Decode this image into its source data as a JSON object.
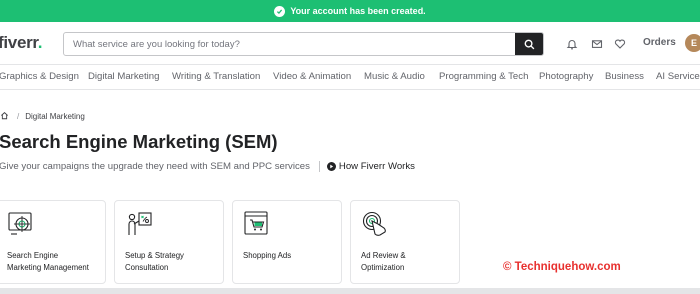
{
  "banner": {
    "message": "Your account has been created."
  },
  "header": {
    "logo": "fiverr",
    "logo_dot": ".",
    "search_placeholder": "What service are you looking for today?",
    "orders_label": "Orders",
    "avatar_initial": "E"
  },
  "categories": [
    "Graphics & Design",
    "Digital Marketing",
    "Writing & Translation",
    "Video & Animation",
    "Music & Audio",
    "Programming & Tech",
    "Photography",
    "Business",
    "AI Services"
  ],
  "breadcrumb": {
    "separator": "/",
    "current": "Digital Marketing"
  },
  "page": {
    "title": "Search Engine Marketing (SEM)",
    "subtitle": "Give your campaigns the upgrade they need with SEM and PPC services",
    "how_link": "How Fiverr Works"
  },
  "cards": [
    {
      "line1": "Search Engine",
      "line2": "Marketing Management",
      "icon": "target-screen-icon"
    },
    {
      "line1": "Setup & Strategy",
      "line2": "Consultation",
      "icon": "strategy-board-icon"
    },
    {
      "line1": "Shopping Ads",
      "line2": "",
      "icon": "shopping-cart-screen-icon"
    },
    {
      "line1": "Ad Review &",
      "line2": "Optimization",
      "icon": "touch-target-icon"
    }
  ],
  "watermark": "© Techniquehow.com",
  "colors": {
    "brand_green": "#1dbf73",
    "watermark_red": "#e8312f"
  }
}
